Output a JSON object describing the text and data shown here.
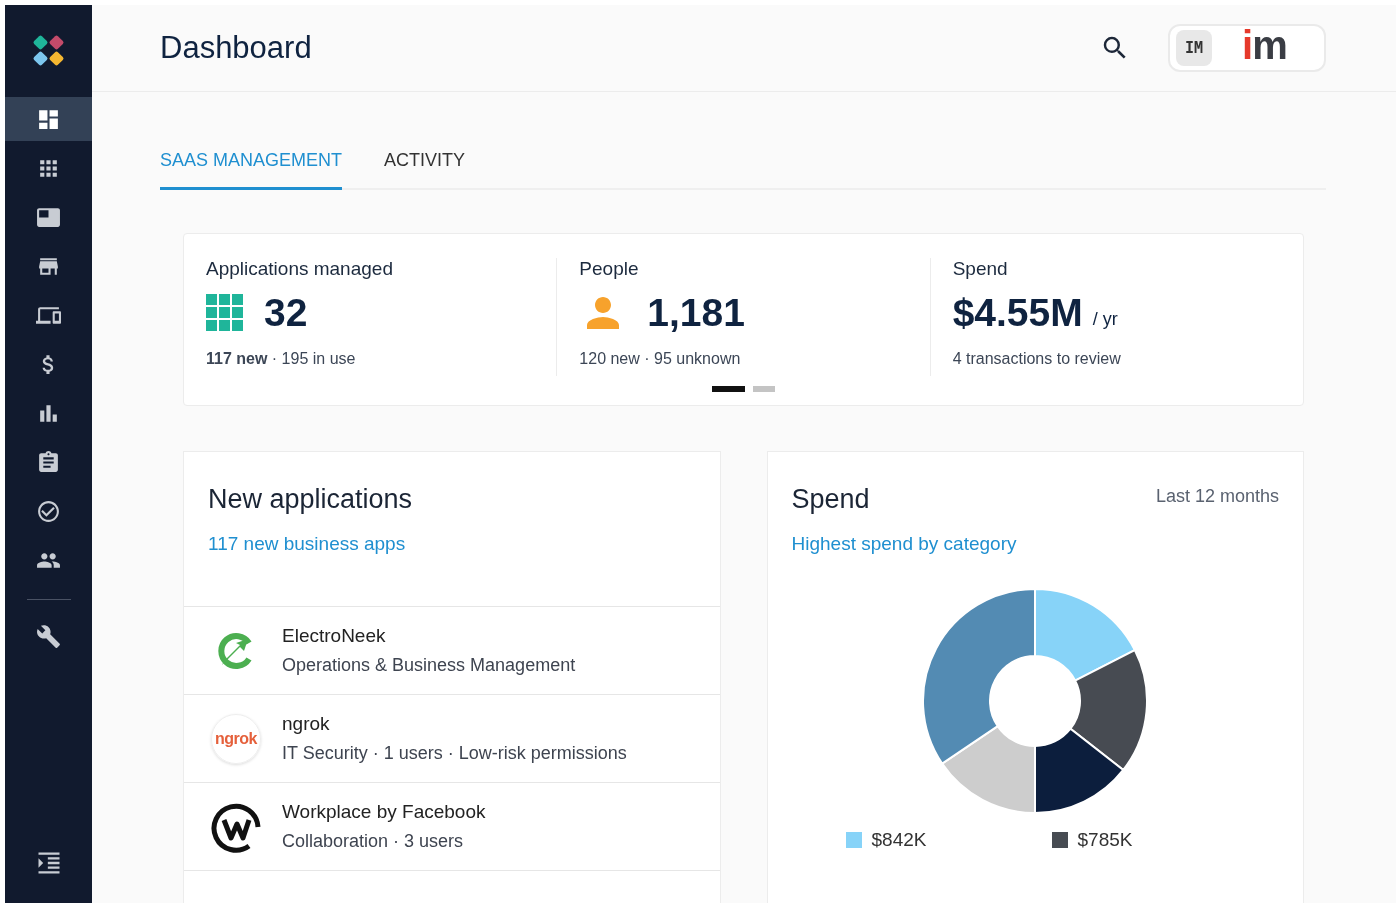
{
  "sidebar": {
    "items": [
      {
        "selected": true
      },
      {
        "selected": false
      },
      {
        "selected": false
      },
      {
        "selected": false
      },
      {
        "selected": false
      },
      {
        "selected": false
      },
      {
        "selected": false
      },
      {
        "selected": false
      },
      {
        "selected": false
      },
      {
        "selected": false
      }
    ],
    "tools": [
      {
        "selected": false
      }
    ]
  },
  "header": {
    "title": "Dashboard",
    "avatar": "IM",
    "brand_logo": {
      "accent": "i",
      "rest": "m"
    }
  },
  "tabs": [
    {
      "label": "SAAS MANAGEMENT",
      "selected": true
    },
    {
      "label": "ACTIVITY",
      "selected": false
    }
  ],
  "stats": [
    {
      "kind": "apps",
      "label": "Applications managed",
      "value": "32",
      "note": "**117 new** · 195 in use"
    },
    {
      "kind": "people",
      "label": "People",
      "value": "1,181",
      "note": "120 new · 95 unknown"
    },
    {
      "kind": "spend",
      "label": "Spend",
      "value": "$4.55M",
      "unit": "/ yr",
      "note": "4 transactions to review"
    }
  ],
  "pager": [
    {
      "selected": true
    },
    {
      "selected": false
    }
  ],
  "new_applications": {
    "title": "New applications",
    "link": "117 new business apps",
    "rows": [
      {
        "kind": "bolt",
        "name": "ElectroNeek",
        "detail": "Operations & Business Management"
      },
      {
        "kind": "text",
        "logo_text": "ngrok",
        "name": "ngrok",
        "detail": "IT Security · 1 users · Low-risk permissions"
      },
      {
        "kind": "ring",
        "name": "Workplace by Facebook",
        "detail": "Collaboration · 3 users"
      }
    ]
  },
  "spend": {
    "title": "Spend",
    "period": "Last 12 months",
    "link": "Highest spend by category",
    "legend": [
      {
        "label": "$842K",
        "color": "#87d3f8"
      },
      {
        "label": "$785K",
        "color": "#474b52"
      }
    ]
  }
}
